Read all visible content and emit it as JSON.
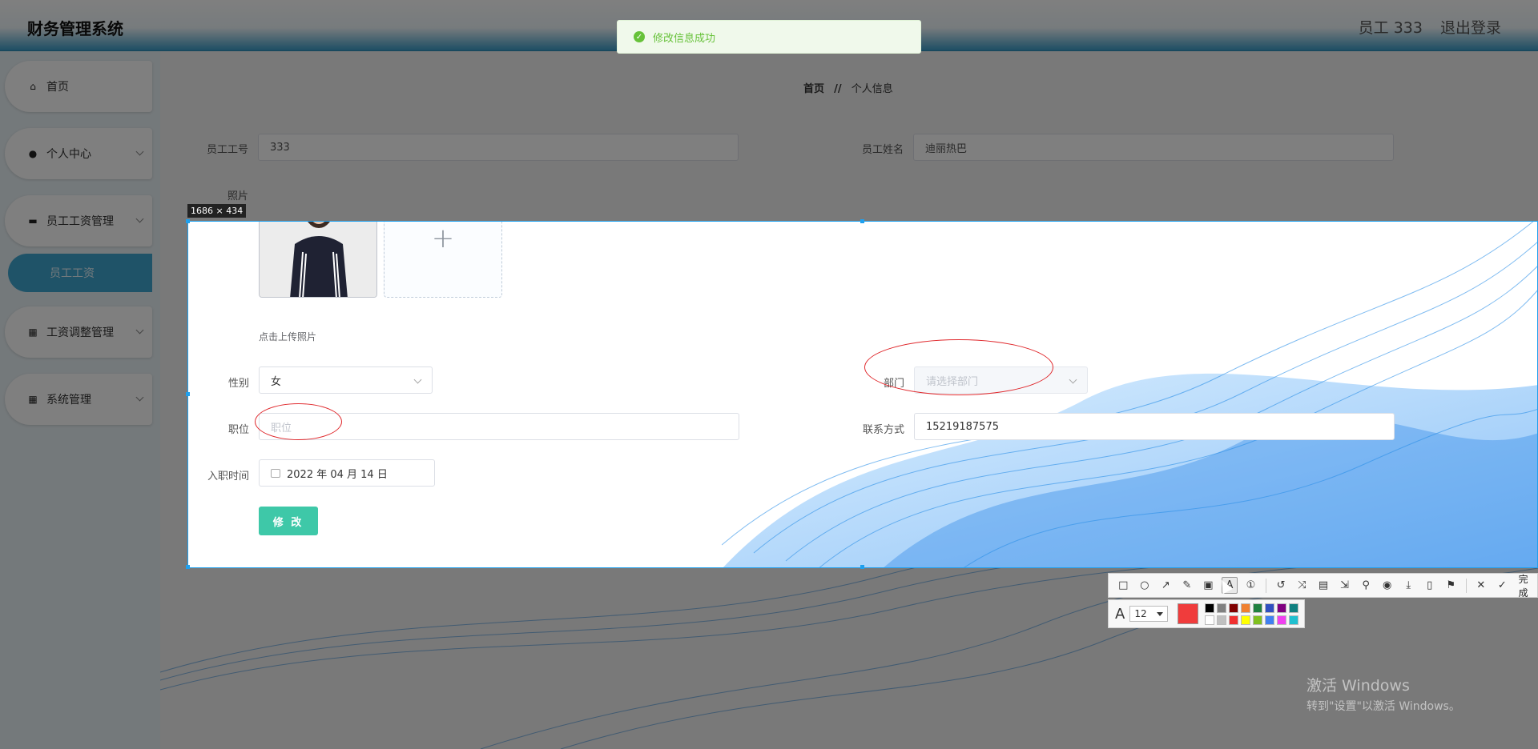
{
  "header": {
    "app_title": "财务管理系统",
    "user_label": "员工 333",
    "logout_label": "退出登录"
  },
  "toast": {
    "message": "修改信息成功"
  },
  "sidebar": {
    "items": [
      {
        "label": "首页",
        "icon": "home-icon"
      },
      {
        "label": "个人中心",
        "icon": "user-icon"
      },
      {
        "label": "员工工资管理",
        "icon": "wallet-icon"
      },
      {
        "label": "工资调整管理",
        "icon": "grid-icon"
      },
      {
        "label": "系统管理",
        "icon": "grid-icon"
      }
    ],
    "sub_item": "员工工资"
  },
  "breadcrumb": {
    "home": "首页",
    "separator": "//",
    "current": "个人信息"
  },
  "form": {
    "employee_no_label": "员工工号",
    "employee_no_value": "333",
    "employee_name_label": "员工姓名",
    "employee_name_value": "迪丽热巴",
    "photo_label": "照片",
    "upload_hint": "点击上传照片",
    "gender_label": "性别",
    "gender_value": "女",
    "department_label": "部门",
    "department_placeholder": "请选择部门",
    "position_label": "职位",
    "position_placeholder": "职位",
    "contact_label": "联系方式",
    "contact_value": "15219187575",
    "hire_date_label": "入职时间",
    "hire_date_value": "2022 年 04 月 14 日",
    "submit_label": "修 改"
  },
  "capture": {
    "size_label": "1686 × 434",
    "done_label": "完成",
    "font_size": "12",
    "current_color": "#f03c3c",
    "palette": [
      "#000000",
      "#808080",
      "#800000",
      "#f08030",
      "#208040",
      "#3050c0",
      "#800080",
      "#108080",
      "#ffffff",
      "#c0c0c0",
      "#f03030",
      "#ffff00",
      "#80c020",
      "#4080f0",
      "#f040f0",
      "#20c0d0"
    ]
  },
  "watermark": {
    "title": "激活 Windows",
    "subtitle": "转到\"设置\"以激活 Windows。"
  }
}
